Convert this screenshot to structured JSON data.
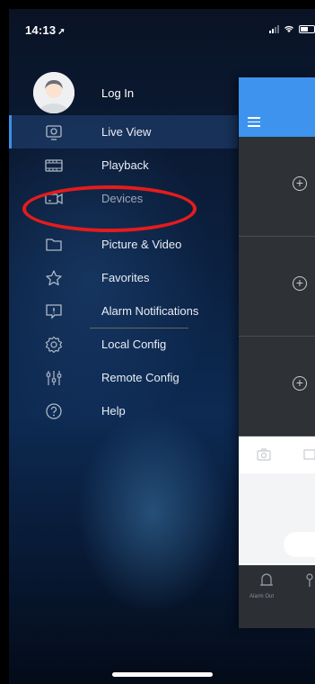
{
  "status_bar": {
    "time": "14:13",
    "location_icon": "location-arrow-icon"
  },
  "drawer": {
    "login_label": "Log In",
    "items": [
      {
        "label": "Live View",
        "icon": "live-view-icon",
        "active": true
      },
      {
        "label": "Playback",
        "icon": "playback-icon"
      },
      {
        "label": "Devices",
        "icon": "devices-camera-icon",
        "dim": true
      },
      {
        "label": "Picture & Video",
        "icon": "folder-icon"
      },
      {
        "label": "Favorites",
        "icon": "star-icon"
      },
      {
        "label": "Alarm Notifications",
        "icon": "alarm-message-icon"
      },
      {
        "label": "Local Config",
        "icon": "gear-icon"
      },
      {
        "label": "Remote Config",
        "icon": "sliders-icon"
      },
      {
        "label": "Help",
        "icon": "help-icon"
      }
    ]
  },
  "background_panel": {
    "bottom_label": "Alarm Out"
  },
  "colors": {
    "accent": "#3d93ee",
    "annotation": "#e51c1c"
  }
}
